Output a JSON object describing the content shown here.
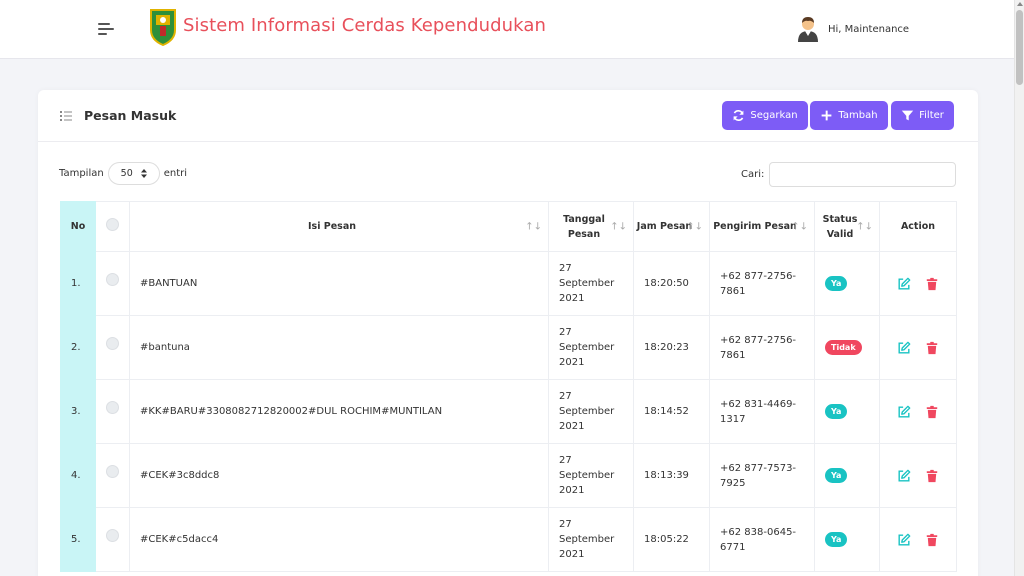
{
  "app": {
    "title": "Sistem Informasi Cerdas Kependudukan",
    "user_greeting": "Hi, Maintenance"
  },
  "card": {
    "title": "Pesan Masuk",
    "buttons": {
      "refresh": "Segarkan",
      "add": "Tambah",
      "filter": "Filter"
    }
  },
  "length": {
    "prefix": "Tampilan",
    "value": "50",
    "suffix": "entri"
  },
  "search": {
    "label": "Cari:",
    "value": ""
  },
  "table": {
    "headers": {
      "no": "No",
      "isi": "Isi Pesan",
      "tanggal": "Tanggal Pesan",
      "jam": "Jam Pesan",
      "pengirim": "Pengirim Pesan",
      "status": "Status Valid",
      "action": "Action"
    },
    "rows": [
      {
        "no": "1.",
        "isi": "#BANTUAN",
        "tanggal": "27 September 2021",
        "jam": "18:20:50",
        "pengirim": "+62 877-2756-7861",
        "status": "Ya"
      },
      {
        "no": "2.",
        "isi": "#bantuna",
        "tanggal": "27 September 2021",
        "jam": "18:20:23",
        "pengirim": "+62 877-2756-7861",
        "status": "Tidak"
      },
      {
        "no": "3.",
        "isi": "#KK#BARU#3308082712820002#DUL ROCHIM#MUNTILAN",
        "tanggal": "27 September 2021",
        "jam": "18:14:52",
        "pengirim": "+62 831-4469-1317",
        "status": "Ya"
      },
      {
        "no": "4.",
        "isi": "#CEK#3c8ddc8",
        "tanggal": "27 September 2021",
        "jam": "18:13:39",
        "pengirim": "+62 877-7573-7925",
        "status": "Ya"
      },
      {
        "no": "5.",
        "isi": "#CEK#c5dacc4",
        "tanggal": "27 September 2021",
        "jam": "18:05:22",
        "pengirim": "+62 838-0645-6771",
        "status": "Ya"
      }
    ]
  },
  "colors": {
    "accent": "#7d5cf6",
    "title": "#e8505b",
    "badge_ya": "#19c3c3",
    "badge_tidak": "#f0475f",
    "no_column": "#c9f5f6",
    "edit_icon": "#19c3c3",
    "delete_icon": "#f0475f"
  },
  "icons": {
    "menu": "hamburger-icon",
    "refresh": "refresh-icon",
    "add": "plus-icon",
    "filter": "filter-icon",
    "edit": "edit-icon",
    "delete": "trash-icon"
  }
}
